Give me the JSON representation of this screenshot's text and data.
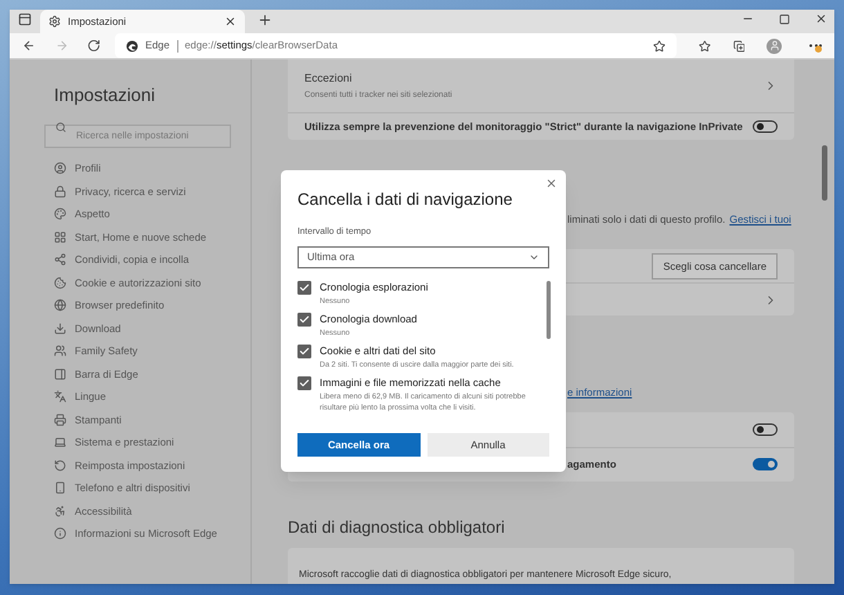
{
  "browser": {
    "tabs": [
      {
        "title": "Impostazioni",
        "selected": true
      }
    ],
    "address": {
      "site": "Edge",
      "url_start": "edge://",
      "url_host": "settings",
      "url_path": "/clearBrowserData"
    }
  },
  "sidebar": {
    "title": "Impostazioni",
    "search": {
      "placeholder": "Ricerca nelle impostazioni"
    },
    "items": [
      {
        "label": "Profili"
      },
      {
        "label": "Privacy, ricerca e servizi"
      },
      {
        "label": "Aspetto"
      },
      {
        "label": "Start, Home e nuove schede"
      },
      {
        "label": "Condividi, copia e incolla"
      },
      {
        "label": "Cookie e autorizzazioni sito"
      },
      {
        "label": "Browser predefinito"
      },
      {
        "label": "Download"
      },
      {
        "label": "Family Safety"
      },
      {
        "label": "Barra di Edge"
      },
      {
        "label": "Lingue"
      },
      {
        "label": "Stampanti"
      },
      {
        "label": "Sistema e prestazioni"
      },
      {
        "label": "Reimposta impostazioni"
      },
      {
        "label": "Telefono e altri dispositivi"
      },
      {
        "label": "Accessibilità"
      },
      {
        "label": "Informazioni su Microsoft Edge"
      }
    ]
  },
  "main": {
    "tracking_card": {
      "rows": [
        {
          "kind": "link",
          "title": "Eccezioni",
          "description": "Consenti tutti i tracker nei siti selezionati"
        },
        {
          "kind": "toggle",
          "title": "Utilizza sempre la prevenzione del monitoraggio \"Strict\" durante la navigazione InPrivate",
          "on": false
        }
      ]
    },
    "clear_note": {
      "text": "liminati solo i dati di questo profilo.",
      "link": "Gestisci i tuoi"
    },
    "clear_card": {
      "rows": [
        {
          "kind": "button",
          "button": "Scegli cosa cancellare"
        },
        {
          "kind": "link"
        }
      ]
    },
    "more_info_link": "e informazioni",
    "options_card": {
      "rows": [
        {
          "kind": "toggle",
          "on": false
        },
        {
          "kind": "toggle",
          "title": "agamento",
          "on": true
        }
      ]
    },
    "diagnostics": {
      "heading": "Dati di diagnostica obbligatori",
      "text": "Microsoft raccoglie dati di diagnostica obbligatori per mantenere Microsoft Edge sicuro,"
    }
  },
  "dialog": {
    "title": "Cancella i dati di navigazione",
    "range_label": "Intervallo di tempo",
    "range_value": "Ultima ora",
    "options": [
      {
        "label": "Cronologia esplorazioni",
        "description": "Nessuno",
        "checked": true
      },
      {
        "label": "Cronologia download",
        "description": "Nessuno",
        "checked": true
      },
      {
        "label": "Cookie e altri dati del sito",
        "description": "Da 2 siti. Ti consente di uscire dalla maggior parte dei siti.",
        "checked": true
      },
      {
        "label": "Immagini e file memorizzati nella cache",
        "description": "Libera meno di 62,9 MB. Il caricamento di alcuni siti potrebbe risultare più lento la prossima volta che li visiti.",
        "checked": true
      }
    ],
    "buttons": [
      {
        "label": "Cancella ora",
        "kind": "primary"
      },
      {
        "label": "Annulla",
        "kind": "secondary"
      }
    ]
  }
}
